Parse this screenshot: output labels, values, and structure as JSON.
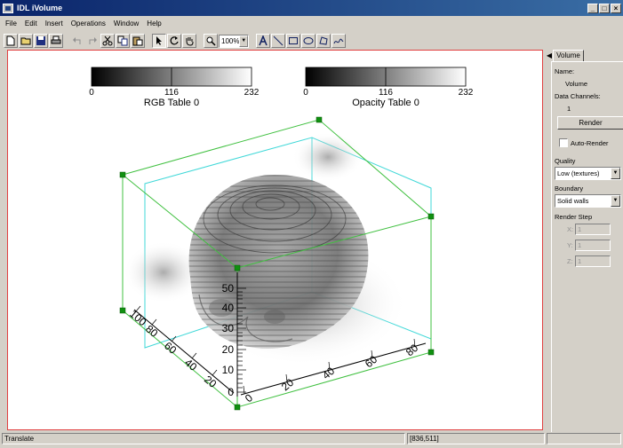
{
  "window": {
    "title": "IDL iVolume"
  },
  "window_buttons": {
    "minimize": "_",
    "maximize": "□",
    "close": "×"
  },
  "menu": {
    "items": [
      "File",
      "Edit",
      "Insert",
      "Operations",
      "Window",
      "Help"
    ]
  },
  "toolbar": {
    "zoom_value": "100%"
  },
  "canvas": {
    "colorbars": [
      {
        "min": "0",
        "mid": "116",
        "max": "232",
        "title": "RGB Table 0"
      },
      {
        "min": "0",
        "mid": "116",
        "max": "232",
        "title": "Opacity Table 0"
      }
    ],
    "axis_z_ticks": [
      "0",
      "10",
      "20",
      "30",
      "40",
      "50"
    ],
    "axis_x_ticks": [
      "0",
      "20",
      "40",
      "60",
      "80"
    ],
    "axis_y_ticks": [
      "20",
      "40",
      "60",
      "80",
      "100"
    ],
    "colors": {
      "box": "#40c040",
      "inner_box": "#40d8d8",
      "handle": "#109010",
      "border": "#e04040"
    }
  },
  "panel": {
    "tab_label": "Volume",
    "name_label": "Name:",
    "name_value": "Volume",
    "channels_label": "Data Channels:",
    "channels_value": "1",
    "render_button": "Render",
    "auto_render_label": "Auto-Render",
    "quality_label": "Quality",
    "quality_value": "Low (textures)",
    "boundary_label": "Boundary",
    "boundary_value": "Solid walls",
    "render_step_label": "Render Step",
    "step_x_label": "X:",
    "step_x_value": "1",
    "step_y_label": "Y:",
    "step_y_value": "1",
    "step_z_label": "Z:",
    "step_z_value": "1"
  },
  "status": {
    "mode": "Translate",
    "coords": "[836,511]"
  }
}
